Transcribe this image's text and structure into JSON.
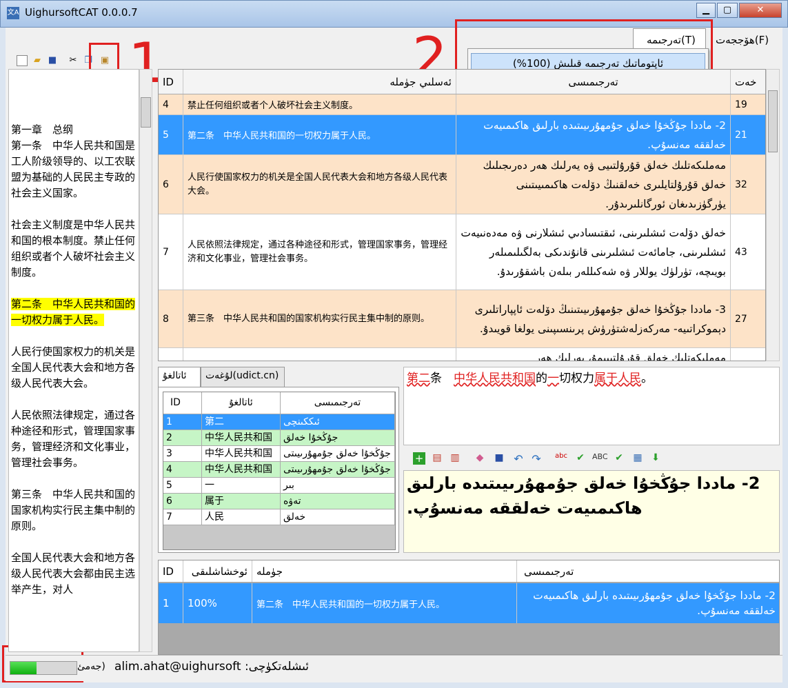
{
  "window": {
    "title": "UighursoftCAT 0.0.0.7",
    "minimize": "▁",
    "maximize": "▢",
    "close": "✕"
  },
  "menu": {
    "file": "ھۆججەت(F)",
    "translate": "تەرجىمە(T)",
    "auto_translate": "ئاپتوماتىك تەرجىمە قىلىش (100%)"
  },
  "annotations": {
    "n1": "1",
    "n2": "2"
  },
  "source_paragraphs": [
    "第一章　总纲\n第一条　中华人民共和国是工人阶级领导的、以工农联盟为基础的人民民主专政的社会主义国家。",
    "社会主义制度是中华人民共和国的根本制度。禁止任何组织或者个人破坏社会主义制度。",
    "第二条　中华人民共和国的一切权力属于人民。",
    "人民行使国家权力的机关是全国人民代表大会和地方各级人民代表大会。",
    "人民依照法律规定，通过各种途径和形式，管理国家事务，管理经济和文化事业，管理社会事务。",
    "第三条　中华人民共和国的国家机构实行民主集中制的原则。",
    "全国人民代表大会和地方各级人民代表大会都由民主选举产生，对人"
  ],
  "grid": {
    "headers": {
      "id": "ID",
      "source": "ئەسلىي جۈملە",
      "target": "تەرجىمىسى",
      "chars": "خەت"
    },
    "rows": [
      {
        "id": "4",
        "source": "禁止任何组织或者个人破坏社会主义制度。",
        "target": "",
        "chars": "19"
      },
      {
        "id": "5",
        "source": "第二条　中华人民共和国的一切权力属于人民。",
        "target": "2- ماددا جۇڭخۇا خەلق جۇمھۇرىيىتىدە بارلىق ھاكىمىيەت خەلققە مەنسۇپ.",
        "chars": "21"
      },
      {
        "id": "6",
        "source": "人民行使国家权力的机关是全国人民代表大会和地方各级人民代表大会。",
        "target": "مەملىكەتلىك خەلق قۇرۇلتىيى ۋە يەرلىك ھەر دەرىجىلىك خەلق قۇرۇلتايلىرى خەلقنىڭ دۆلەت ھاكىمىيىتىنى يۈرگۈزىدىغان ئورگانلىرىدۇر.",
        "chars": "32"
      },
      {
        "id": "7",
        "source": "人民依照法律规定，通过各种途径和形式，管理国家事务，管理经济和文化事业，管理社会事务。",
        "target": "خەلق دۆلەت ئىشلىرىنى، ئىقتىسادىي ئىشلارنى ۋە مەدەنىيەت ئىشلىرىنى، جامائەت ئىشلىرىنى قانۇندىكى بەلگىلىمىلەر بويىچە، تۈرلۈك يوللار ۋە شەكىللەر بىلەن باشقۇرىدۇ.",
        "chars": "43"
      },
      {
        "id": "8",
        "source": "第三条　中华人民共和国的国家机构实行民主集中制的原则。",
        "target": "3- ماددا جۇڭخۇا خەلق جۇمھۇرىيىتىنىڭ دۆلەت ئاپپاراتلىرى دېموكراتىيە- مەركەزلەشتۈرۈش پرىنسىپىنى يولغا قويىدۇ.",
        "chars": "27"
      },
      {
        "id": "",
        "source": "",
        "target": "مەملىكەتلىك خەلق قۇرۇلتىيىمۇ، يەرلىك ھەر",
        "chars": ""
      }
    ]
  },
  "tabs": {
    "glossary": "ئاتالغۇ",
    "dict": "لۇغەت(udict.cn)"
  },
  "glossary": {
    "headers": {
      "id": "ID",
      "term": "ئاتالغۇ",
      "translation": "تەرجىمىسى"
    },
    "rows": [
      {
        "id": "1",
        "term": "第二",
        "translation": "ئىككىنچى"
      },
      {
        "id": "2",
        "term": "中华人民共和国",
        "translation": "جۇڭخۇا خەلق"
      },
      {
        "id": "3",
        "term": "中华人民共和国",
        "translation": "جۇڭخۇا خەلق جۇمھۇرىيىتى"
      },
      {
        "id": "4",
        "term": "中华人民共和国",
        "translation": "جۇڭخۇا خەلق جۇمھۇرىيىتى"
      },
      {
        "id": "5",
        "term": "一",
        "translation": "بىر"
      },
      {
        "id": "6",
        "term": "属于",
        "translation": "تەۋە"
      },
      {
        "id": "7",
        "term": "人民",
        "translation": "خەلق"
      }
    ]
  },
  "source_sentence": {
    "a": "第二",
    "b": "条　",
    "c": "中华人民共和国",
    "d": "的",
    "e": "一",
    "f": "切权力",
    "g": "属于人民",
    "h": "。"
  },
  "target_text": "2- ماددا جۇڭخۇا خەلق جۇمھۇرىيىتىدە بارلىق ھاكىمىيەت خەلققە مەنسۇپ.",
  "tm": {
    "headers": {
      "id": "ID",
      "similarity": "ئوخشاشلىقى",
      "sentence": "جۈملە",
      "translation": "تەرجىمىسى"
    },
    "row": {
      "id": "1",
      "similarity": "100%",
      "sentence": "第二条　中华人民共和国的一切权力属于人民。",
      "translation": "2- ماددا جۇڭخۇا خەلق جۇمھۇرىيىتىدە بارلىق ھاكىمىيەت خەلققە مەنسۇپ."
    }
  },
  "status": {
    "user": "ئىشلەتكۈچى: alim.ahat@uighursoft",
    "progress_label": "(جەمئ",
    "progress": 0.4
  },
  "colors": {
    "selected_row": "#3399ff",
    "peach_row": "#fde3c8",
    "green_row": "#c6f5c6",
    "highlight": "#ffff00",
    "red": "#e02020"
  }
}
